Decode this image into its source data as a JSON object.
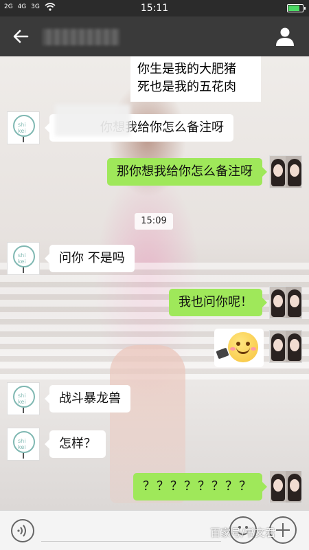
{
  "status_bar": {
    "signal_1": "2G",
    "signal_2": "4G",
    "signal_3": "3G",
    "time": "15:11",
    "battery_level": 0.85
  },
  "header": {
    "back_icon": "back-arrow-icon",
    "contact_icon": "person-icon"
  },
  "messages": {
    "top_line_1": "你生是我的大肥猪",
    "top_line_2": "死也是我的五花肉",
    "m1": "你想我给你怎么备注呀",
    "m2": "那你想我给你怎么备注呀",
    "timestamp": "15:09",
    "m3": "问你 不是吗",
    "m4": "我也问你呢！",
    "m5": "战斗暴龙兽",
    "m6": "怎样？",
    "m7": "？？？？？？？？"
  },
  "bottom_bar": {
    "voice_icon": "voice-icon",
    "emoji_icon": "smiley-icon",
    "plus_icon": "plus-icon"
  },
  "watermark": "百家号/书文君",
  "colors": {
    "header_bg": "#3a3a3a",
    "sent_bubble": "#9fe85a",
    "received_bubble": "#ffffff"
  }
}
